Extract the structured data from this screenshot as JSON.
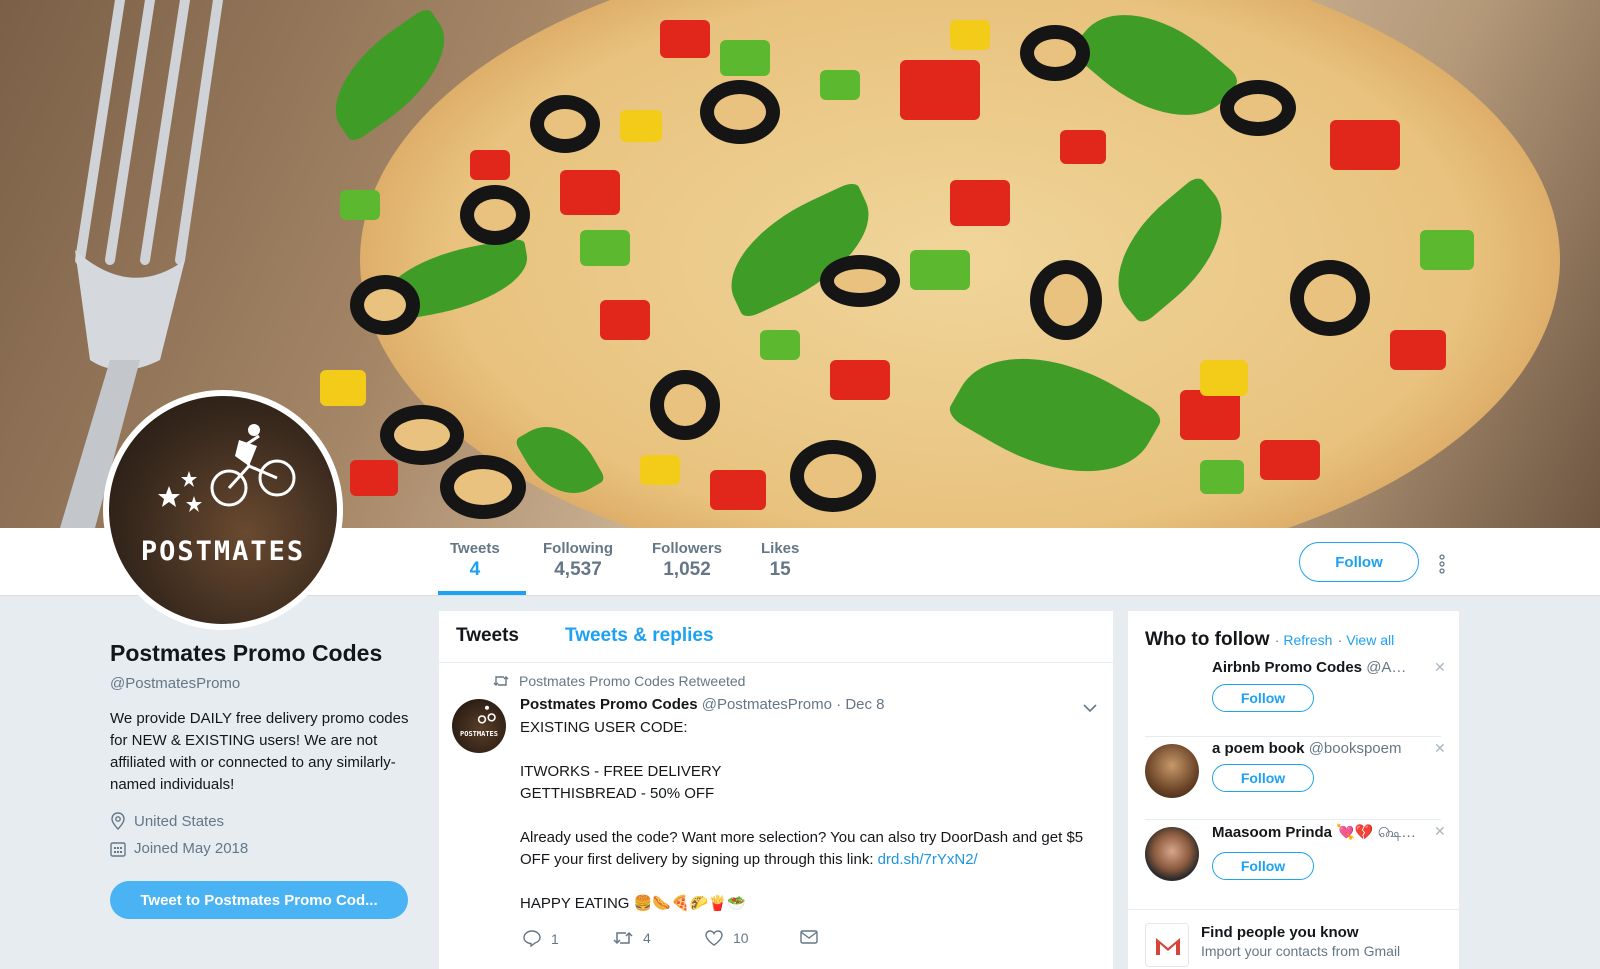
{
  "profile": {
    "name": "Postmates Promo Codes",
    "handle": "@PostmatesPromo",
    "bio": "We provide DAILY free delivery promo codes for NEW & EXISTING users! We are not affiliated with or connected to any similarly-named individuals!",
    "location": "United States",
    "joined": "Joined May 2018",
    "tweet_to_label": "Tweet to Postmates Promo Cod...",
    "avatar_brand": "POSTMATES"
  },
  "stats": [
    {
      "label": "Tweets",
      "value": "4"
    },
    {
      "label": "Following",
      "value": "4,537"
    },
    {
      "label": "Followers",
      "value": "1,052"
    },
    {
      "label": "Likes",
      "value": "15"
    }
  ],
  "header": {
    "follow_label": "Follow",
    "more_icon": "vertical-dots-icon"
  },
  "timeline": {
    "tabs": [
      "Tweets",
      "Tweets & replies"
    ],
    "tweet": {
      "retweet_context": "Postmates Promo Codes Retweeted",
      "author_name": "Postmates Promo Codes",
      "author_handle": "@PostmatesPromo",
      "date": "· Dec 8",
      "avatar_text": "POSTMATES",
      "lines": [
        "EXISTING USER CODE:",
        "",
        "ITWORKS - FREE DELIVERY",
        "GETTHISBREAD - 50% OFF",
        "",
        "Already used the code? Want more selection? You can also try DoorDash and get $5 OFF your first delivery by signing up through this link:",
        "",
        "HAPPY EATING 🍔🌭🍕🌮🍟🥗"
      ],
      "link": "drd.sh/7rYxN2/",
      "replies": "1",
      "retweets": "4",
      "likes": "10"
    }
  },
  "who_to_follow": {
    "title": "Who to follow",
    "refresh": "Refresh",
    "view_all": "View all",
    "suggestions": [
      {
        "name": "Airbnb Promo Codes",
        "handle": "@A…",
        "follow": "Follow"
      },
      {
        "name": "a poem book",
        "handle": "@bookspoem",
        "follow": "Follow"
      },
      {
        "name": "Maasoom Prinda 💘💔",
        "handle": "௸…",
        "follow": "Follow"
      }
    ],
    "find_people_title": "Find people you know",
    "find_people_sub": "Import your contacts from Gmail"
  },
  "colors": {
    "accent": "#1da1f2",
    "tweet_to_button": "#4ab3f4",
    "background": "#e6ecf0"
  }
}
